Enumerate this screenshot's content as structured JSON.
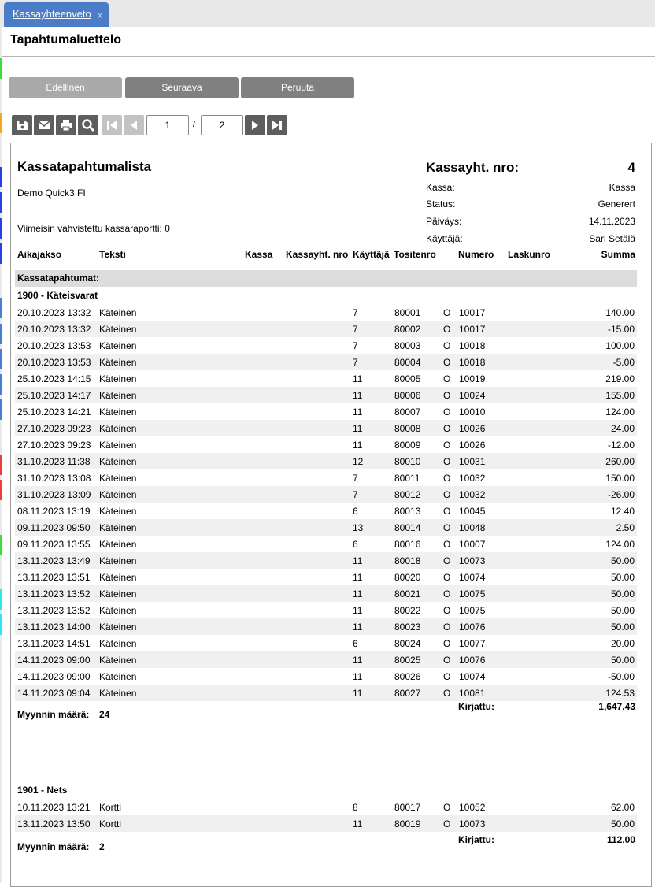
{
  "tab": {
    "label": "Kassayhteenveto",
    "close": "x"
  },
  "page_title": "Tapahtumaluettelo",
  "buttons": {
    "previous": "Edellinen",
    "next": "Seuraava",
    "cancel": "Peruuta"
  },
  "pager": {
    "current": "1",
    "separator": "/",
    "total": "2"
  },
  "toolbar_icons": [
    "save-icon",
    "email-icon",
    "print-icon",
    "search-icon",
    "first-page-icon",
    "previous-page-icon",
    "next-page-icon",
    "last-page-icon"
  ],
  "colors": {
    "tab": "#4a7cc7",
    "button": "#808080",
    "button_disabled": "#a9a9a9",
    "section_bg": "#dcdcdc",
    "row_alt": "#f0f0f0"
  },
  "report": {
    "title": "Kassatapahtumalista",
    "company": "Demo Quick3 FI",
    "last_report": "Viimeisin vahvistettu kassaraportti: 0",
    "nro_label": "Kassayht. nro:",
    "nro_value": "4",
    "meta": [
      {
        "label": "Kassa:",
        "value": "Kassa"
      },
      {
        "label": "Status:",
        "value": "Generert"
      },
      {
        "label": "Päiväys:",
        "value": "14.11.2023"
      },
      {
        "label": "Käyttäjä:",
        "value": "Sari Setälä"
      }
    ],
    "columns": {
      "period": "Aikajakso",
      "text": "Teksti",
      "kassa": "Kassa",
      "nro": "Kassayht. nro",
      "user": "Käyttäjä",
      "voucher": "Tositenro",
      "number": "Numero",
      "invoice": "Laskunro",
      "sum": "Summa"
    },
    "section_label": "Kassatapahtumat:",
    "groups": [
      {
        "title": "1900 - Käteisvarat",
        "rows": [
          {
            "date": "20.10.2023 13:32",
            "text": "Käteinen",
            "user": "7",
            "voucher": "80001",
            "flag": "O",
            "number": "10017",
            "sum": "140.00"
          },
          {
            "date": "20.10.2023 13:32",
            "text": "Käteinen",
            "user": "7",
            "voucher": "80002",
            "flag": "O",
            "number": "10017",
            "sum": "-15.00"
          },
          {
            "date": "20.10.2023 13:53",
            "text": "Käteinen",
            "user": "7",
            "voucher": "80003",
            "flag": "O",
            "number": "10018",
            "sum": "100.00"
          },
          {
            "date": "20.10.2023 13:53",
            "text": "Käteinen",
            "user": "7",
            "voucher": "80004",
            "flag": "O",
            "number": "10018",
            "sum": "-5.00"
          },
          {
            "date": "25.10.2023 14:15",
            "text": "Käteinen",
            "user": "11",
            "voucher": "80005",
            "flag": "O",
            "number": "10019",
            "sum": "219.00"
          },
          {
            "date": "25.10.2023 14:17",
            "text": "Käteinen",
            "user": "11",
            "voucher": "80006",
            "flag": "O",
            "number": "10024",
            "sum": "155.00"
          },
          {
            "date": "25.10.2023 14:21",
            "text": "Käteinen",
            "user": "11",
            "voucher": "80007",
            "flag": "O",
            "number": "10010",
            "sum": "124.00"
          },
          {
            "date": "27.10.2023 09:23",
            "text": "Käteinen",
            "user": "11",
            "voucher": "80008",
            "flag": "O",
            "number": "10026",
            "sum": "24.00"
          },
          {
            "date": "27.10.2023 09:23",
            "text": "Käteinen",
            "user": "11",
            "voucher": "80009",
            "flag": "O",
            "number": "10026",
            "sum": "-12.00"
          },
          {
            "date": "31.10.2023 11:38",
            "text": "Käteinen",
            "user": "12",
            "voucher": "80010",
            "flag": "O",
            "number": "10031",
            "sum": "260.00"
          },
          {
            "date": "31.10.2023 13:08",
            "text": "Käteinen",
            "user": "7",
            "voucher": "80011",
            "flag": "O",
            "number": "10032",
            "sum": "150.00"
          },
          {
            "date": "31.10.2023 13:09",
            "text": "Käteinen",
            "user": "7",
            "voucher": "80012",
            "flag": "O",
            "number": "10032",
            "sum": "-26.00"
          },
          {
            "date": "08.11.2023 13:19",
            "text": "Käteinen",
            "user": "6",
            "voucher": "80013",
            "flag": "O",
            "number": "10045",
            "sum": "12.40"
          },
          {
            "date": "09.11.2023 09:50",
            "text": "Käteinen",
            "user": "13",
            "voucher": "80014",
            "flag": "O",
            "number": "10048",
            "sum": "2.50"
          },
          {
            "date": "09.11.2023 13:55",
            "text": "Käteinen",
            "user": "6",
            "voucher": "80016",
            "flag": "O",
            "number": "10007",
            "sum": "124.00"
          },
          {
            "date": "13.11.2023 13:49",
            "text": "Käteinen",
            "user": "11",
            "voucher": "80018",
            "flag": "O",
            "number": "10073",
            "sum": "50.00"
          },
          {
            "date": "13.11.2023 13:51",
            "text": "Käteinen",
            "user": "11",
            "voucher": "80020",
            "flag": "O",
            "number": "10074",
            "sum": "50.00"
          },
          {
            "date": "13.11.2023 13:52",
            "text": "Käteinen",
            "user": "11",
            "voucher": "80021",
            "flag": "O",
            "number": "10075",
            "sum": "50.00"
          },
          {
            "date": "13.11.2023 13:52",
            "text": "Käteinen",
            "user": "11",
            "voucher": "80022",
            "flag": "O",
            "number": "10075",
            "sum": "50.00"
          },
          {
            "date": "13.11.2023 14:00",
            "text": "Käteinen",
            "user": "11",
            "voucher": "80023",
            "flag": "O",
            "number": "10076",
            "sum": "50.00"
          },
          {
            "date": "13.11.2023 14:51",
            "text": "Käteinen",
            "user": "6",
            "voucher": "80024",
            "flag": "O",
            "number": "10077",
            "sum": "20.00"
          },
          {
            "date": "14.11.2023 09:00",
            "text": "Käteinen",
            "user": "11",
            "voucher": "80025",
            "flag": "O",
            "number": "10076",
            "sum": "50.00"
          },
          {
            "date": "14.11.2023 09:00",
            "text": "Käteinen",
            "user": "11",
            "voucher": "80026",
            "flag": "O",
            "number": "10074",
            "sum": "-50.00"
          },
          {
            "date": "14.11.2023 09:04",
            "text": "Käteinen",
            "user": "11",
            "voucher": "80027",
            "flag": "O",
            "number": "10081",
            "sum": "124.53"
          }
        ],
        "booked_label": "Kirjattu:",
        "booked_total": "1,647.43",
        "sales_label": "Myynnin määrä:",
        "sales_count": "24"
      },
      {
        "title": "1901 - Nets",
        "rows": [
          {
            "date": "10.11.2023 13:21",
            "text": "Kortti",
            "user": "8",
            "voucher": "80017",
            "flag": "O",
            "number": "10052",
            "sum": "62.00"
          },
          {
            "date": "13.11.2023 13:50",
            "text": "Kortti",
            "user": "11",
            "voucher": "80019",
            "flag": "O",
            "number": "10073",
            "sum": "50.00"
          }
        ],
        "booked_label": "Kirjattu:",
        "booked_total": "112.00",
        "sales_label": "Myynnin määrä:",
        "sales_count": "2"
      }
    ]
  }
}
